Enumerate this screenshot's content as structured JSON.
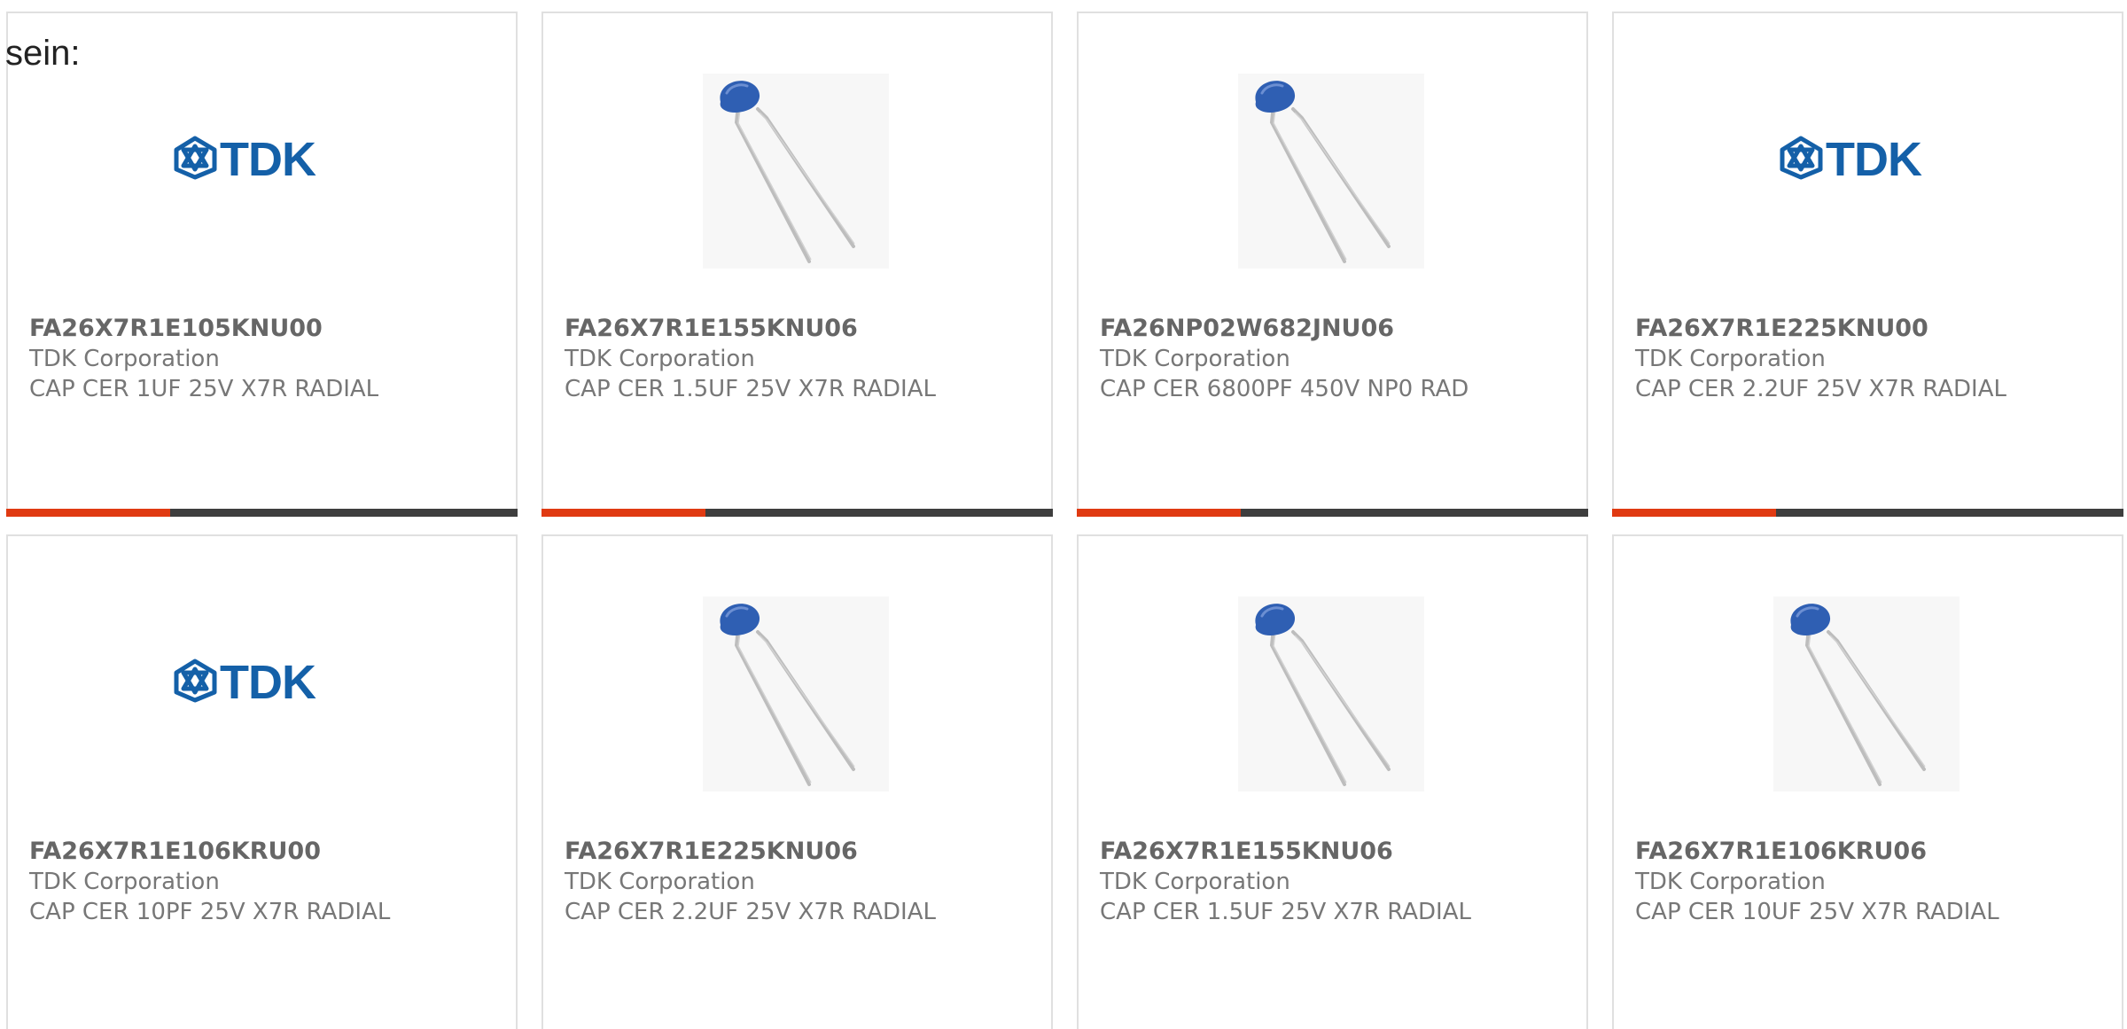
{
  "intro_text": "sein:",
  "colors": {
    "accent": "#e03a12",
    "bar": "#3e3e3e",
    "tdk_blue": "#1460a8",
    "capacitor_blue": "#2f5fb3"
  },
  "products": [
    {
      "part_number": "FA26X7R1E105KNU00",
      "manufacturer": "TDK Corporation",
      "description": "CAP CER 1UF 25V X7R RADIAL",
      "image": "tdk-logo",
      "logo_text": "TDK",
      "progress": 0.32
    },
    {
      "part_number": "FA26X7R1E155KNU06",
      "manufacturer": "TDK Corporation",
      "description": "CAP CER 1.5UF 25V X7R RADIAL",
      "image": "ceramic-capacitor",
      "progress": 0.32
    },
    {
      "part_number": "FA26NP02W682JNU06",
      "manufacturer": "TDK Corporation",
      "description": "CAP CER 6800PF 450V NP0 RAD",
      "image": "ceramic-capacitor",
      "progress": 0.32
    },
    {
      "part_number": "FA26X7R1E225KNU00",
      "manufacturer": "TDK Corporation",
      "description": "CAP CER 2.2UF 25V X7R RADIAL",
      "image": "tdk-logo",
      "logo_text": "TDK",
      "progress": 0.32
    },
    {
      "part_number": "FA26X7R1E106KRU00",
      "manufacturer": "TDK Corporation",
      "description": "CAP CER 10PF 25V X7R RADIAL",
      "image": "tdk-logo",
      "logo_text": "TDK"
    },
    {
      "part_number": "FA26X7R1E225KNU06",
      "manufacturer": "TDK Corporation",
      "description": "CAP CER 2.2UF 25V X7R RADIAL",
      "image": "ceramic-capacitor"
    },
    {
      "part_number": "FA26X7R1E155KNU06",
      "manufacturer": "TDK Corporation",
      "description": "CAP CER 1.5UF 25V X7R RADIAL",
      "image": "ceramic-capacitor"
    },
    {
      "part_number": "FA26X7R1E106KRU06",
      "manufacturer": "TDK Corporation",
      "description": "CAP CER 10UF 25V X7R RADIAL",
      "image": "ceramic-capacitor"
    }
  ]
}
